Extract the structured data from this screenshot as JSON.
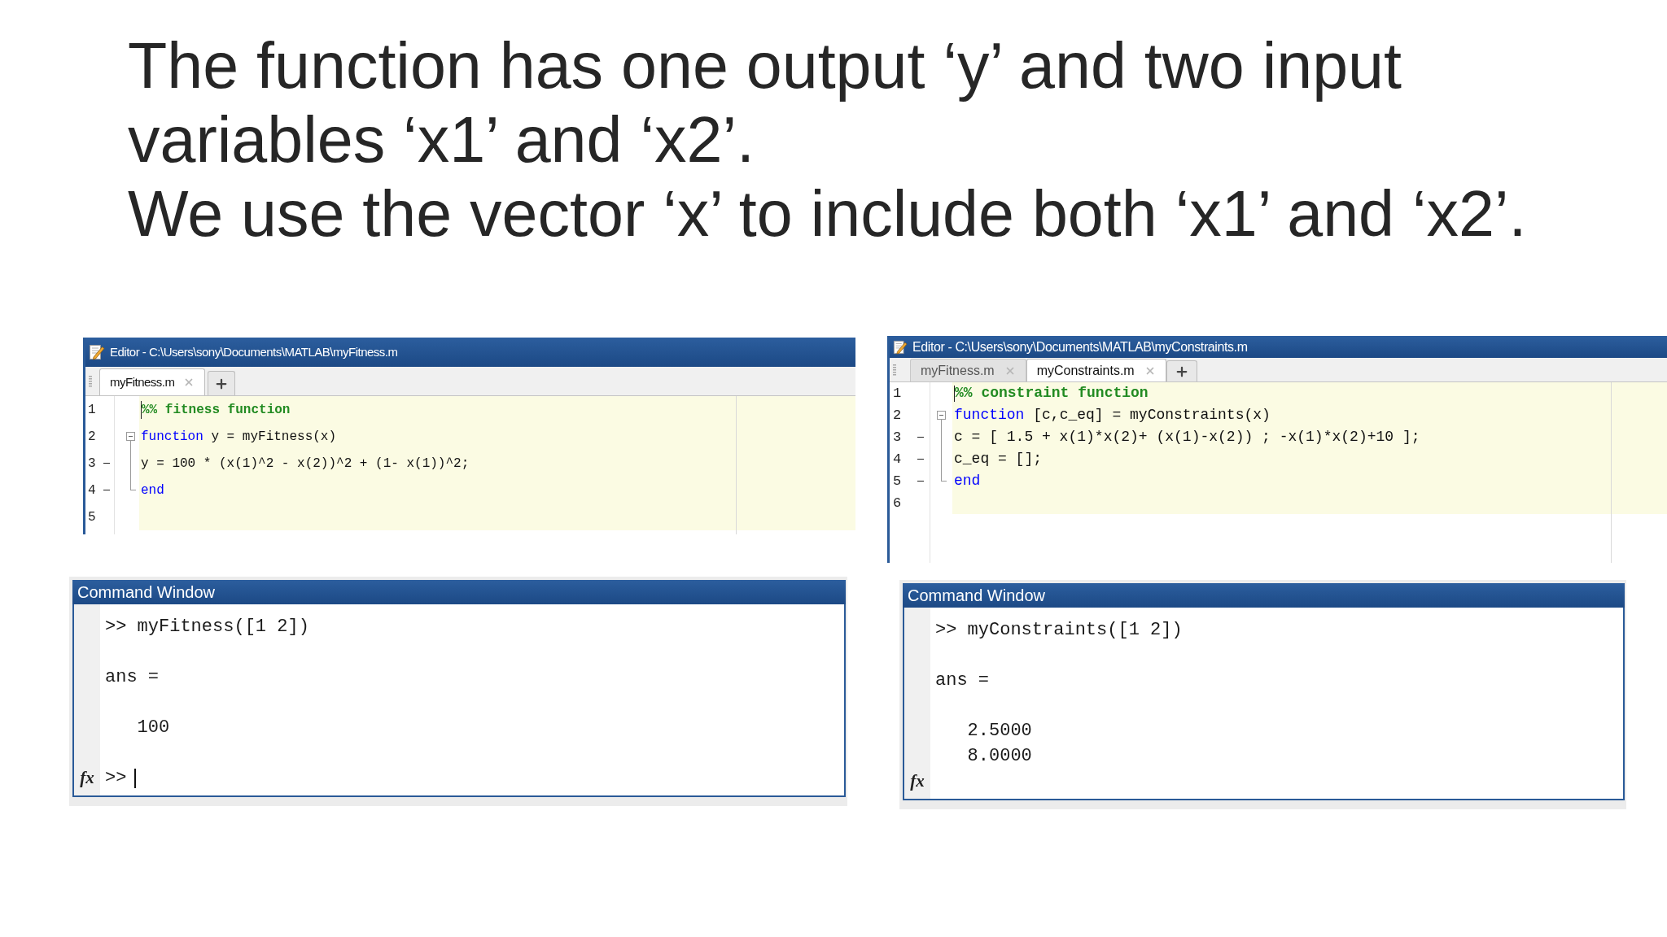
{
  "slide": {
    "paragraphs": [
      "The function has one output ‘y’ and two input variables ‘x1’ and ‘x2’.",
      "We use the vector ‘x’ to include both ‘x1’ and ‘x2’."
    ]
  },
  "editors": [
    {
      "title": "Editor - C:\\Users\\sony\\Documents\\MATLAB\\myFitness.m",
      "tabs": [
        {
          "label": "myFitness.m",
          "selected": true
        }
      ],
      "lines": [
        {
          "number": "1",
          "kind": "plain",
          "cursor": true,
          "executable": false,
          "tokens": [
            {
              "kind": "comment",
              "text": "%% fitness function"
            }
          ]
        },
        {
          "number": "2",
          "kind": "fold-start",
          "cursor": false,
          "executable": false,
          "tokens": [
            {
              "kind": "keyword",
              "text": "function"
            },
            {
              "kind": "plain",
              "text": " y = myFitness(x)"
            }
          ]
        },
        {
          "number": "3",
          "kind": "fold-body",
          "cursor": false,
          "executable": true,
          "tokens": [
            {
              "kind": "plain",
              "text": "y = 100 * (x(1)^2 - x(2))^2 + (1- x(1))^2;"
            }
          ]
        },
        {
          "number": "4",
          "kind": "fold-end",
          "cursor": false,
          "executable": true,
          "tokens": [
            {
              "kind": "keyword",
              "text": "end"
            }
          ]
        },
        {
          "number": "5",
          "kind": "plain",
          "cursor": false,
          "executable": false
        }
      ]
    },
    {
      "title": "Editor - C:\\Users\\sony\\Documents\\MATLAB\\myConstraints.m",
      "tabs": [
        {
          "label": "myFitness.m",
          "selected": false
        },
        {
          "label": "myConstraints.m",
          "selected": true
        }
      ],
      "lines": [
        {
          "number": "1",
          "kind": "plain",
          "cursor": true,
          "executable": false,
          "tokens": [
            {
              "kind": "comment",
              "text": "%% constraint function"
            }
          ]
        },
        {
          "number": "2",
          "kind": "fold-start",
          "cursor": false,
          "executable": false,
          "tokens": [
            {
              "kind": "keyword",
              "text": "function"
            },
            {
              "kind": "plain",
              "text": " [c,c_eq] = myConstraints(x)"
            }
          ]
        },
        {
          "number": "3",
          "kind": "fold-body",
          "cursor": false,
          "executable": true,
          "tokens": [
            {
              "kind": "plain",
              "text": "c = [ 1.5 + x(1)*x(2)+ (x(1)-x(2)) ; -x(1)*x(2)+10 ];"
            }
          ]
        },
        {
          "number": "4",
          "kind": "fold-body",
          "cursor": false,
          "executable": true,
          "tokens": [
            {
              "kind": "plain",
              "text": "c_eq = [];"
            }
          ]
        },
        {
          "number": "5",
          "kind": "fold-end",
          "cursor": false,
          "executable": true,
          "tokens": [
            {
              "kind": "keyword",
              "text": "end"
            }
          ]
        },
        {
          "number": "6",
          "kind": "plain",
          "cursor": false,
          "executable": false
        }
      ]
    }
  ],
  "command_windows": [
    {
      "title": "Command Window",
      "lines": [
        {
          "kind": "command",
          "text": ">> myFitness([1 2])"
        },
        {
          "kind": "output",
          "text": "ans ="
        },
        {
          "kind": "value",
          "text": "100"
        }
      ],
      "function_button": "fx",
      "prompt": {
        "text": ">>",
        "cursor": true
      }
    },
    {
      "title": "Command Window",
      "lines": [
        {
          "kind": "command",
          "text": ">> myConstraints([1 2])"
        },
        {
          "kind": "output",
          "text": "ans ="
        },
        {
          "kind": "value",
          "text": "2.5000"
        },
        {
          "kind": "value",
          "text": "8.0000"
        }
      ],
      "function_button": "fx"
    }
  ]
}
